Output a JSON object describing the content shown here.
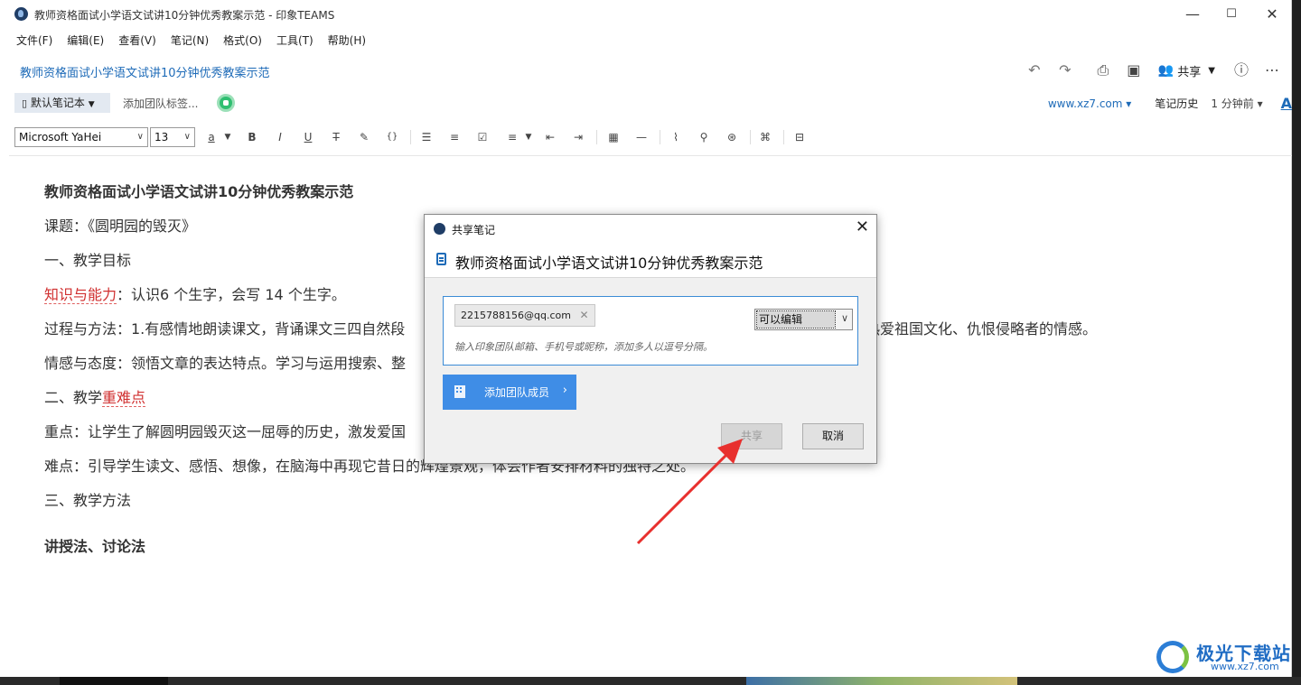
{
  "window": {
    "title": "教师资格面试小学语文试讲10分钟优秀教案示范 - 印象TEAMS",
    "minimize": "—",
    "maximize": "☐",
    "close": "✕"
  },
  "menu": [
    "文件(F)",
    "编辑(E)",
    "查看(V)",
    "笔记(N)",
    "格式(O)",
    "工具(T)",
    "帮助(H)"
  ],
  "note_title": "教师资格面试小学语文试讲10分钟优秀教案示范",
  "right_tools": {
    "share_label": "共享"
  },
  "notebook": {
    "name": "默认笔记本",
    "tag_placeholder": "添加团队标签...",
    "link": "www.xz7.com",
    "history": "笔记历史",
    "time": "1 分钟前",
    "aa": "A"
  },
  "format": {
    "font": "Microsoft YaHei",
    "size": "13"
  },
  "document": {
    "heading": "教师资格面试小学语文试讲10分钟优秀教案示范",
    "topic": "课题：《圆明园的毁灭》",
    "sec1": "一、教学目标",
    "goal1_label": "知识与能力",
    "goal1_text": "：认识6 个生字，会写 14 个生字。",
    "goal2_a": "过程与方法：1.有感情地朗读课文，背诵课文三四自然段",
    "goal2_b": "热爱祖国文化、仇恨侵略者的情感。",
    "goal3": "情感与态度：领悟文章的表达特点。学习与运用搜索、整",
    "sec2_a": "二、教学",
    "sec2_b": "重难点",
    "key": "重点：让学生了解圆明园毁灭这一屈辱的历史，激发爱国",
    "diff": "难点：引导学生读文、感悟、想像，在脑海中再现它昔日的辉煌景观，体会作者安排材料的独特之处。",
    "sec3": "三、教学方法",
    "method": "讲授法、讨论法"
  },
  "dialog": {
    "title": "共享笔记",
    "note_title": "教师资格面试小学语文试讲10分钟优秀教案示范",
    "recipient": "2215788156@qq.com",
    "permission": "可以编辑",
    "hint": "输入印象团队邮箱、手机号或昵称，添加多人以逗号分隔。",
    "add_team": "添加团队成员",
    "share": "共享",
    "cancel": "取消"
  },
  "watermark": {
    "name": "极光下载站",
    "url": "www.xz7.com"
  },
  "colors": {
    "accent": "#1e6bb8",
    "button_blue": "#3f8de6",
    "arrow": "#e8302e",
    "badge_green": "#2fbf71"
  }
}
